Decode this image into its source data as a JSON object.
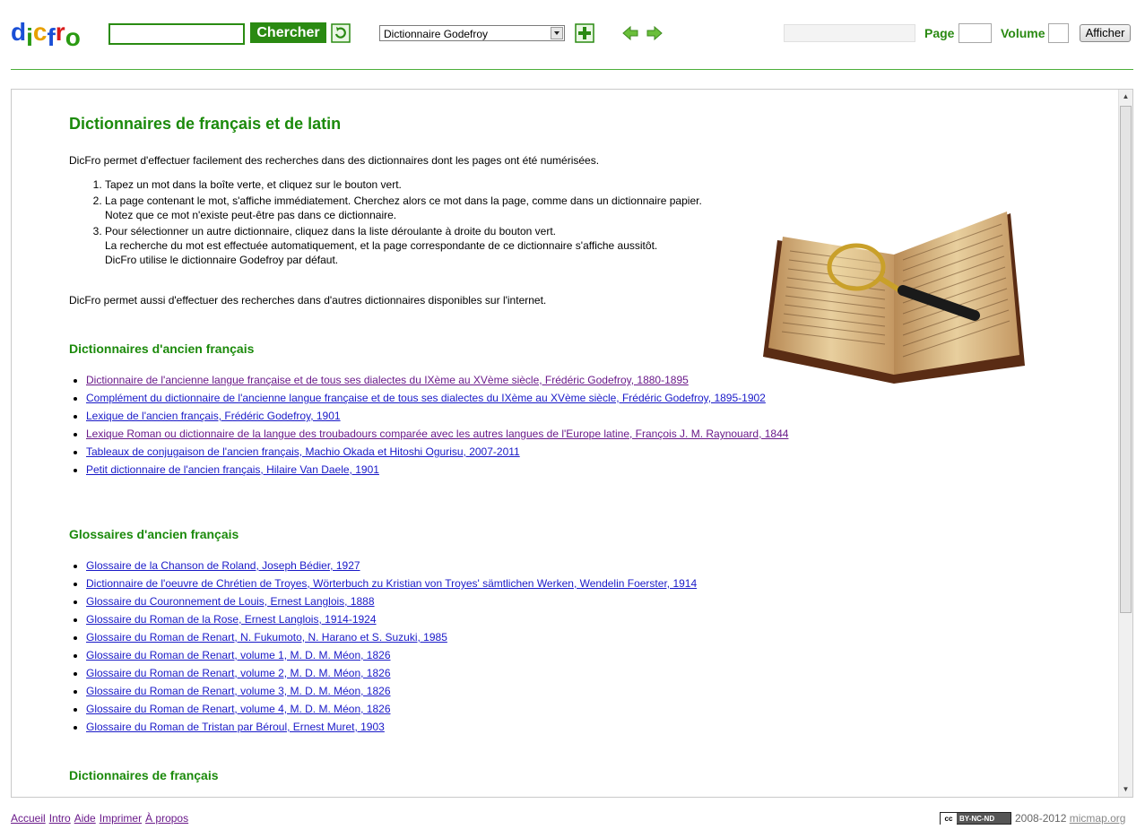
{
  "header": {
    "logo_letters": [
      {
        "ch": "d",
        "color": "#1a4fd6"
      },
      {
        "ch": "i",
        "color": "#2a9a12"
      },
      {
        "ch": "c",
        "color": "#e8a000"
      },
      {
        "ch": "f",
        "color": "#1a4fd6"
      },
      {
        "ch": "r",
        "color": "#d81a1a"
      },
      {
        "ch": "o",
        "color": "#2a9a12"
      }
    ],
    "search_value": "",
    "search_button": "Chercher",
    "dictionary_selected": "Dictionnaire Godefroy",
    "page_label": "Page",
    "page_value": "",
    "volume_label": "Volume",
    "volume_value": "",
    "show_button": "Afficher",
    "icons": [
      "refresh-icon",
      "add-icon",
      "back-arrow-icon",
      "forward-arrow-icon"
    ]
  },
  "content": {
    "title": "Dictionnaires de français et de latin",
    "intro": "DicFro permet d'effectuer facilement des recherches dans des dictionnaires dont les pages ont été numérisées.",
    "steps": [
      {
        "lines": [
          "Tapez un mot dans la boîte verte, et cliquez sur le bouton vert."
        ]
      },
      {
        "lines": [
          "La page contenant le mot, s'affiche immédiatement. Cherchez alors ce mot dans la page, comme dans un dictionnaire papier.",
          "Notez que ce mot n'existe peut-être pas dans ce dictionnaire."
        ]
      },
      {
        "lines": [
          "Pour sélectionner un autre dictionnaire, cliquez dans la liste déroulante à droite du bouton vert.",
          "La recherche du mot est effectuée automatiquement, et la page correspondante de ce dictionnaire s'affiche aussitôt.",
          "DicFro utilise le dictionnaire Godefroy par défaut."
        ]
      }
    ],
    "outro": "DicFro permet aussi d'effectuer des recherches dans d'autres dictionnaires disponibles sur l'internet.",
    "sections": [
      {
        "heading": "Dictionnaires d'ancien français",
        "links": [
          {
            "text": "Dictionnaire de l'ancienne langue française et de tous ses dialectes du IXème au XVème siècle, Frédéric Godefroy, 1880-1895",
            "visited": true
          },
          {
            "text": "Complément du dictionnaire de l'ancienne langue française et de tous ses dialectes du IXème au XVème siècle, Frédéric Godefroy, 1895-1902",
            "visited": false
          },
          {
            "text": "Lexique de l'ancien français, Frédéric Godefroy, 1901",
            "visited": false
          },
          {
            "text": "Lexique Roman ou dictionnaire de la langue des troubadours comparée avec les autres langues de l'Europe latine, François J. M. Raynouard, 1844",
            "visited": true
          },
          {
            "text": "Tableaux de conjugaison de l'ancien français, Machio Okada et Hitoshi Ogurisu, 2007-2011",
            "visited": false
          },
          {
            "text": "Petit dictionnaire de l'ancien français, Hilaire Van Daele, 1901",
            "visited": false
          }
        ]
      },
      {
        "heading": "Glossaires d'ancien français",
        "links": [
          {
            "text": "Glossaire de la Chanson de Roland, Joseph Bédier, 1927",
            "visited": false
          },
          {
            "text": "Dictionnaire de l'oeuvre de Chrétien de Troyes, Wörterbuch zu Kristian von Troyes' sämtlichen Werken, Wendelin Foerster, 1914",
            "visited": false
          },
          {
            "text": "Glossaire du Couronnement de Louis, Ernest Langlois, 1888",
            "visited": false
          },
          {
            "text": "Glossaire du Roman de la Rose, Ernest Langlois, 1914-1924",
            "visited": false
          },
          {
            "text": "Glossaire du Roman de Renart, N. Fukumoto, N. Harano et S. Suzuki, 1985",
            "visited": false
          },
          {
            "text": "Glossaire du Roman de Renart, volume 1, M. D. M. Méon, 1826",
            "visited": false
          },
          {
            "text": "Glossaire du Roman de Renart, volume 2, M. D. M. Méon, 1826",
            "visited": false
          },
          {
            "text": "Glossaire du Roman de Renart, volume 3, M. D. M. Méon, 1826",
            "visited": false
          },
          {
            "text": "Glossaire du Roman de Renart, volume 4, M. D. M. Méon, 1826",
            "visited": false
          },
          {
            "text": "Glossaire du Roman de Tristan par Béroul, Ernest Muret, 1903",
            "visited": false
          }
        ]
      },
      {
        "heading": "Dictionnaires de français",
        "links": []
      }
    ]
  },
  "footer": {
    "links": [
      "Accueil",
      "Intro",
      "Aide",
      "Imprimer",
      "À propos"
    ],
    "cc_badge": "BY-NC-ND",
    "cc_mark": "cc",
    "years": "2008-2012",
    "site": "micmap.org"
  },
  "colors": {
    "brand_green": "#2a8a12",
    "heading_green": "#1b8a0b",
    "link_blue": "#1a1ac8",
    "link_visited": "#6a1a8a"
  }
}
